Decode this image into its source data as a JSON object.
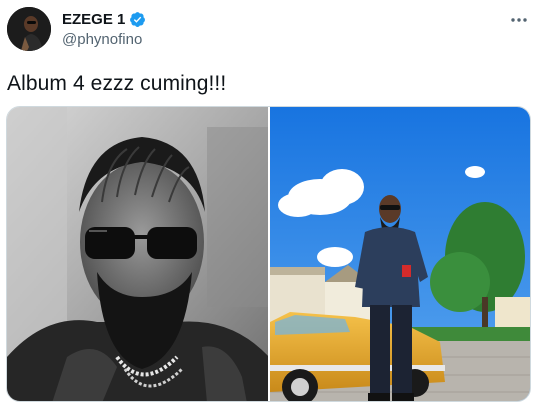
{
  "user": {
    "display_name": "EZEGE 1",
    "handle": "@phynofino",
    "verified": true
  },
  "tweet": {
    "text": "Album 4 ezzz cuming!!!"
  },
  "icons": {
    "verified": "verified-badge-icon",
    "more": "more-horizontal-icon"
  },
  "colors": {
    "verified_blue": "#1d9bf0",
    "text_primary": "#0f1419",
    "text_secondary": "#536471",
    "border": "#cfd9de"
  },
  "media": {
    "photos": [
      {
        "description_icon": "photo-bw-portrait"
      },
      {
        "description_icon": "photo-man-with-yellow-car"
      }
    ]
  }
}
